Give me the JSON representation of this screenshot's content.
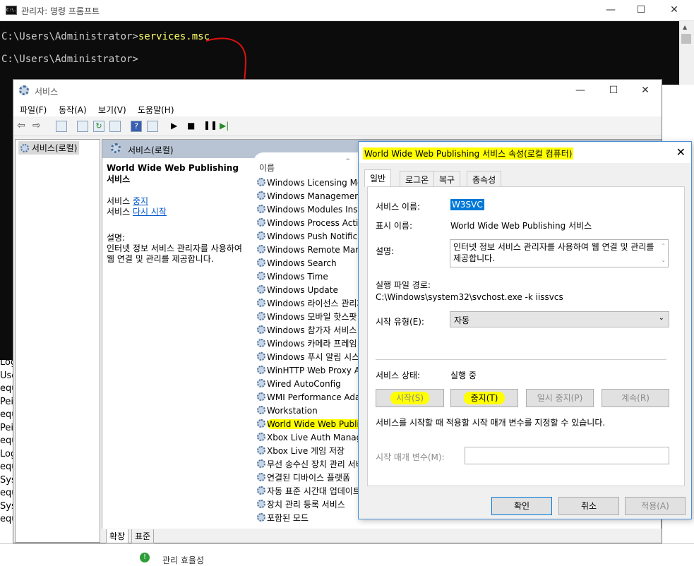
{
  "cmd": {
    "title": "관리자: 명령 프롬프트",
    "icon_text": "C:\\.",
    "line1_prompt": "C:\\Users\\Administrator>",
    "line1_cmd": "services.msc",
    "line2": "C:\\Users\\Administrator>",
    "left_fragments": [
      "Log",
      "Use",
      "equ",
      "Pei",
      "equ",
      "Pei",
      "equ",
      "Log",
      "equ",
      "Sys",
      "equ",
      "Sys",
      "equ"
    ],
    "bottom_text": "관리 효율성"
  },
  "svc": {
    "title": "서비스",
    "menu": [
      "파일(F)",
      "동작(A)",
      "보기(V)",
      "도움말(H)"
    ],
    "tree_node": "서비스(로컬)",
    "header": "서비스(로컬)",
    "desc": {
      "name": "World Wide Web Publishing 서비스",
      "action_prefix": "서비스 ",
      "stop_link": "중지",
      "restart_link": "다시 시작",
      "desc_label": "설명:",
      "desc_text": "인터넷 정보 서비스 관리자를 사용하여 웹 연결 및 관리를 제공합니다."
    },
    "list_header": "이름",
    "rows": [
      "Windows Licensing Monitoring",
      "Windows Management",
      "Windows Modules Installer",
      "Windows Process Activation",
      "Windows Push Notifications",
      "Windows Remote Management",
      "Windows Search",
      "Windows Time",
      "Windows Update",
      "Windows 라이선스 관리자",
      "Windows 모바일 핫스팟",
      "Windows 참가자 서비스",
      "Windows 카메라 프레임",
      "Windows 푸시 알림 시스템",
      "WinHTTP Web Proxy Auto",
      "Wired AutoConfig",
      "WMI Performance Adapter",
      "Workstation",
      "World Wide Web Publishing",
      "Xbox Live Auth Manager",
      "Xbox Live 게임 저장",
      "무선 송수신 장치 관리 서비스",
      "연결된 디바이스 플랫폼",
      "자동 표준 시간대 업데이트",
      "장치 관리 등록 서비스",
      "포함된 모드"
    ],
    "tabs": [
      "확장",
      "표준"
    ]
  },
  "dlg": {
    "title": "World Wide Web Publishing 서비스 속성(로컬 컴퓨터)",
    "tabs": [
      "일반",
      "로그온",
      "복구",
      "종속성"
    ],
    "service_name_label": "서비스 이름:",
    "service_name": "W3SVC",
    "display_name_label": "표시 이름:",
    "display_name": "World Wide Web Publishing 서비스",
    "desc_label": "설명:",
    "desc_text": "인터넷 정보 서비스 관리자를 사용하여 웹 연결 및 관리를 제공합니다.",
    "path_label": "실행 파일 경로:",
    "path": "C:\\Windows\\system32\\svchost.exe -k iissvcs",
    "startup_label": "시작 유형(E):",
    "startup_value": "자동",
    "status_label": "서비스 상태:",
    "status_value": "실행 중",
    "btn_start": "시작(S)",
    "btn_stop": "중지(T)",
    "btn_pause": "일시 중지(P)",
    "btn_resume": "계속(R)",
    "hint": "서비스를 시작할 때 적용할 시작 매개 변수를 지정할 수 있습니다.",
    "param_label": "시작 매개 변수(M):",
    "ok": "확인",
    "cancel": "취소",
    "apply": "적용(A)"
  }
}
